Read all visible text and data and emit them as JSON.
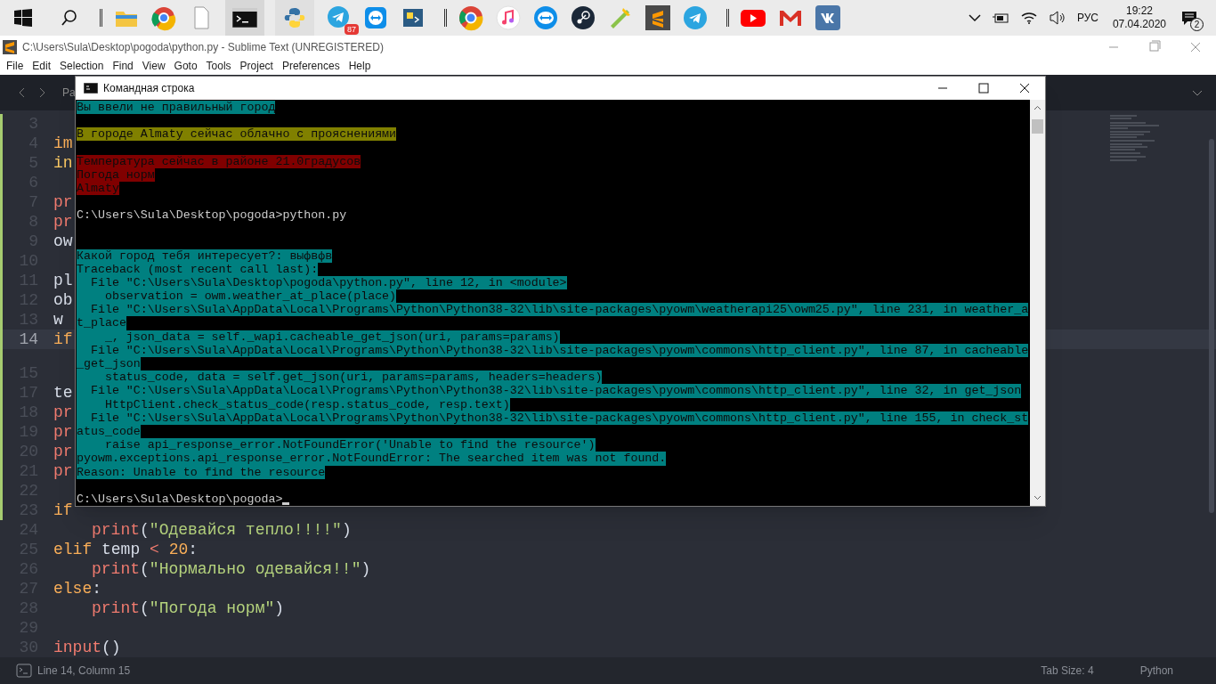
{
  "taskbar": {
    "telegram_badge": "87",
    "language": "РУС",
    "time": "19:22",
    "date": "07.04.2020",
    "notifications": "2"
  },
  "editor": {
    "title": "C:\\Users\\Sula\\Desktop\\pogoda\\python.py - Sublime Text (UNREGISTERED)",
    "menu": [
      "File",
      "Edit",
      "Selection",
      "Find",
      "View",
      "Goto",
      "Tools",
      "Project",
      "Preferences",
      "Help"
    ],
    "tab": "Pa",
    "lines": [
      {
        "number": "3",
        "current": false
      },
      {
        "number": "4",
        "current": false,
        "indented": false,
        "tokens": [
          {
            "kind": "keyword",
            "text": "im"
          }
        ]
      },
      {
        "number": "5",
        "current": false,
        "indented": false,
        "tokens": [
          {
            "kind": "builtin",
            "text": "in"
          }
        ]
      },
      {
        "number": "6",
        "current": false
      },
      {
        "number": "7",
        "current": false,
        "indented": false,
        "tokens": [
          {
            "kind": "function",
            "text": "pr"
          }
        ]
      },
      {
        "number": "8",
        "current": false,
        "indented": false,
        "tokens": [
          {
            "kind": "function",
            "text": "pr"
          }
        ]
      },
      {
        "number": "9",
        "current": false,
        "indented": false,
        "tokens": [
          {
            "kind": "plain",
            "text": "ow"
          }
        ]
      },
      {
        "number": "10",
        "current": false
      },
      {
        "number": "11",
        "current": false,
        "indented": false,
        "tokens": [
          {
            "kind": "plain",
            "text": "pl"
          }
        ]
      },
      {
        "number": "12",
        "current": false,
        "indented": false,
        "tokens": [
          {
            "kind": "plain",
            "text": "ob"
          }
        ]
      },
      {
        "number": "13",
        "current": false,
        "indented": false,
        "tokens": [
          {
            "kind": "plain",
            "text": "w"
          }
        ]
      },
      {
        "number": "14",
        "current": true,
        "indented": false,
        "tokens": [
          {
            "kind": "keyword",
            "text": "if"
          }
        ]
      },
      {
        "current": false
      },
      {
        "number": "15",
        "current": false
      },
      {
        "number": "17",
        "current": false,
        "indented": false,
        "tokens": [
          {
            "kind": "plain",
            "text": "te"
          }
        ]
      },
      {
        "number": "18",
        "current": false,
        "indented": false,
        "tokens": [
          {
            "kind": "function",
            "text": "pr"
          }
        ]
      },
      {
        "number": "19",
        "current": false,
        "indented": false,
        "tokens": [
          {
            "kind": "function",
            "text": "pr"
          }
        ]
      },
      {
        "number": "20",
        "current": false,
        "indented": false,
        "tokens": [
          {
            "kind": "function",
            "text": "pr"
          }
        ]
      },
      {
        "number": "21",
        "current": false,
        "indented": false,
        "tokens": [
          {
            "kind": "function",
            "text": "pr"
          }
        ]
      },
      {
        "number": "22",
        "current": false
      },
      {
        "number": "23",
        "current": false,
        "indented": false,
        "tokens": [
          {
            "kind": "keyword",
            "text": "if"
          }
        ]
      },
      {
        "number": "24",
        "current": false,
        "indented": true,
        "tokens": [
          {
            "kind": "function",
            "text": "print"
          },
          {
            "kind": "plain",
            "text": "("
          },
          {
            "kind": "string",
            "text": "\"Одевайся тепло!!!!\""
          },
          {
            "kind": "plain",
            "text": ")"
          }
        ]
      },
      {
        "number": "25",
        "current": false,
        "indented": false,
        "tokens": [
          {
            "kind": "keyword",
            "text": "elif"
          },
          {
            "kind": "plain",
            "text": " temp "
          },
          {
            "kind": "operator",
            "text": "<"
          },
          {
            "kind": "number",
            "text": " 20"
          },
          {
            "kind": "plain",
            "text": ":"
          }
        ]
      },
      {
        "number": "26",
        "current": false,
        "indented": true,
        "tokens": [
          {
            "kind": "function",
            "text": "print"
          },
          {
            "kind": "plain",
            "text": "("
          },
          {
            "kind": "string",
            "text": "\"Нормально одевайся!!\""
          },
          {
            "kind": "plain",
            "text": ")"
          }
        ]
      },
      {
        "number": "27",
        "current": false,
        "indented": false,
        "tokens": [
          {
            "kind": "keyword",
            "text": "else"
          },
          {
            "kind": "plain",
            "text": ":"
          }
        ]
      },
      {
        "number": "28",
        "current": false,
        "indented": true,
        "tokens": [
          {
            "kind": "function",
            "text": "print"
          },
          {
            "kind": "plain",
            "text": "("
          },
          {
            "kind": "string",
            "text": "\"Погода норм\""
          },
          {
            "kind": "plain",
            "text": ")"
          }
        ]
      },
      {
        "number": "29",
        "current": false
      },
      {
        "number": "30",
        "current": false,
        "indented": false,
        "tokens": [
          {
            "kind": "function",
            "text": "input"
          },
          {
            "kind": "plain",
            "text": "()"
          }
        ]
      }
    ],
    "status_bar": {
      "position": "Line 14, Column 15",
      "tab_size": "Tab Size: 4",
      "syntax": "Python"
    }
  },
  "console": {
    "title": "Командная строка",
    "lines": [
      {
        "kind": "highlight",
        "color": "#008080",
        "text": "Вы ввели не правильный город"
      },
      {
        "kind": "blank"
      },
      {
        "kind": "highlight",
        "color": "#808000",
        "text": "В городе Almaty сейчас облачно с прояснениями"
      },
      {
        "kind": "blank"
      },
      {
        "kind": "highlight",
        "color": "#800000",
        "text": "Температура сейчас в районе 21.0градусов"
      },
      {
        "kind": "highlight",
        "color": "#800000",
        "text": "Погода норм"
      },
      {
        "kind": "highlight",
        "color": "#800000",
        "text": "Almaty"
      },
      {
        "kind": "blank"
      },
      {
        "kind": "plain",
        "text": "C:\\Users\\Sula\\Desktop\\pogoda>python.py"
      },
      {
        "kind": "blank"
      },
      {
        "kind": "blank"
      },
      {
        "kind": "highlight",
        "color": "#008080",
        "text": "Какой город тебя интересует?: выфвфв"
      },
      {
        "kind": "highlight",
        "color": "#008080",
        "text": "Traceback (most recent call last):"
      },
      {
        "kind": "highlight",
        "color": "#008080",
        "text": "  File \"C:\\Users\\Sula\\Desktop\\pogoda\\python.py\", line 12, in <module>"
      },
      {
        "kind": "highlight",
        "color": "#008080",
        "text": "    observation = owm.weather_at_place(place)"
      },
      {
        "kind": "highlight",
        "color": "#008080",
        "text": "  File \"C:\\Users\\Sula\\AppData\\Local\\Programs\\Python\\Python38-32\\lib\\site-packages\\pyowm\\weatherapi25\\owm25.py\", line 231, in weather_a"
      },
      {
        "kind": "highlight",
        "color": "#008080",
        "text": "t_place"
      },
      {
        "kind": "highlight",
        "color": "#008080",
        "text": "    _, json_data = self._wapi.cacheable_get_json(uri, params=params)"
      },
      {
        "kind": "highlight",
        "color": "#008080",
        "text": "  File \"C:\\Users\\Sula\\AppData\\Local\\Programs\\Python\\Python38-32\\lib\\site-packages\\pyowm\\commons\\http_client.py\", line 87, in cacheable"
      },
      {
        "kind": "highlight",
        "color": "#008080",
        "text": "_get_json"
      },
      {
        "kind": "highlight",
        "color": "#008080",
        "text": "    status_code, data = self.get_json(uri, params=params, headers=headers)"
      },
      {
        "kind": "highlight",
        "color": "#008080",
        "text": "  File \"C:\\Users\\Sula\\AppData\\Local\\Programs\\Python\\Python38-32\\lib\\site-packages\\pyowm\\commons\\http_client.py\", line 32, in get_json"
      },
      {
        "kind": "highlight",
        "color": "#008080",
        "text": "    HttpClient.check_status_code(resp.status_code, resp.text)"
      },
      {
        "kind": "highlight",
        "color": "#008080",
        "text": "  File \"C:\\Users\\Sula\\AppData\\Local\\Programs\\Python\\Python38-32\\lib\\site-packages\\pyowm\\commons\\http_client.py\", line 155, in check_st"
      },
      {
        "kind": "highlight",
        "color": "#008080",
        "text": "atus_code"
      },
      {
        "kind": "highlight",
        "color": "#008080",
        "text": "    raise api_response_error.NotFoundError('Unable to find the resource')"
      },
      {
        "kind": "highlight",
        "color": "#008080",
        "text": "pyowm.exceptions.api_response_error.NotFoundError: The searched item was not found."
      },
      {
        "kind": "highlight",
        "color": "#008080",
        "text": "Reason: Unable to find the resource"
      },
      {
        "kind": "blank"
      },
      {
        "kind": "prompt",
        "text": "C:\\Users\\Sula\\Desktop\\pogoda>"
      }
    ]
  }
}
